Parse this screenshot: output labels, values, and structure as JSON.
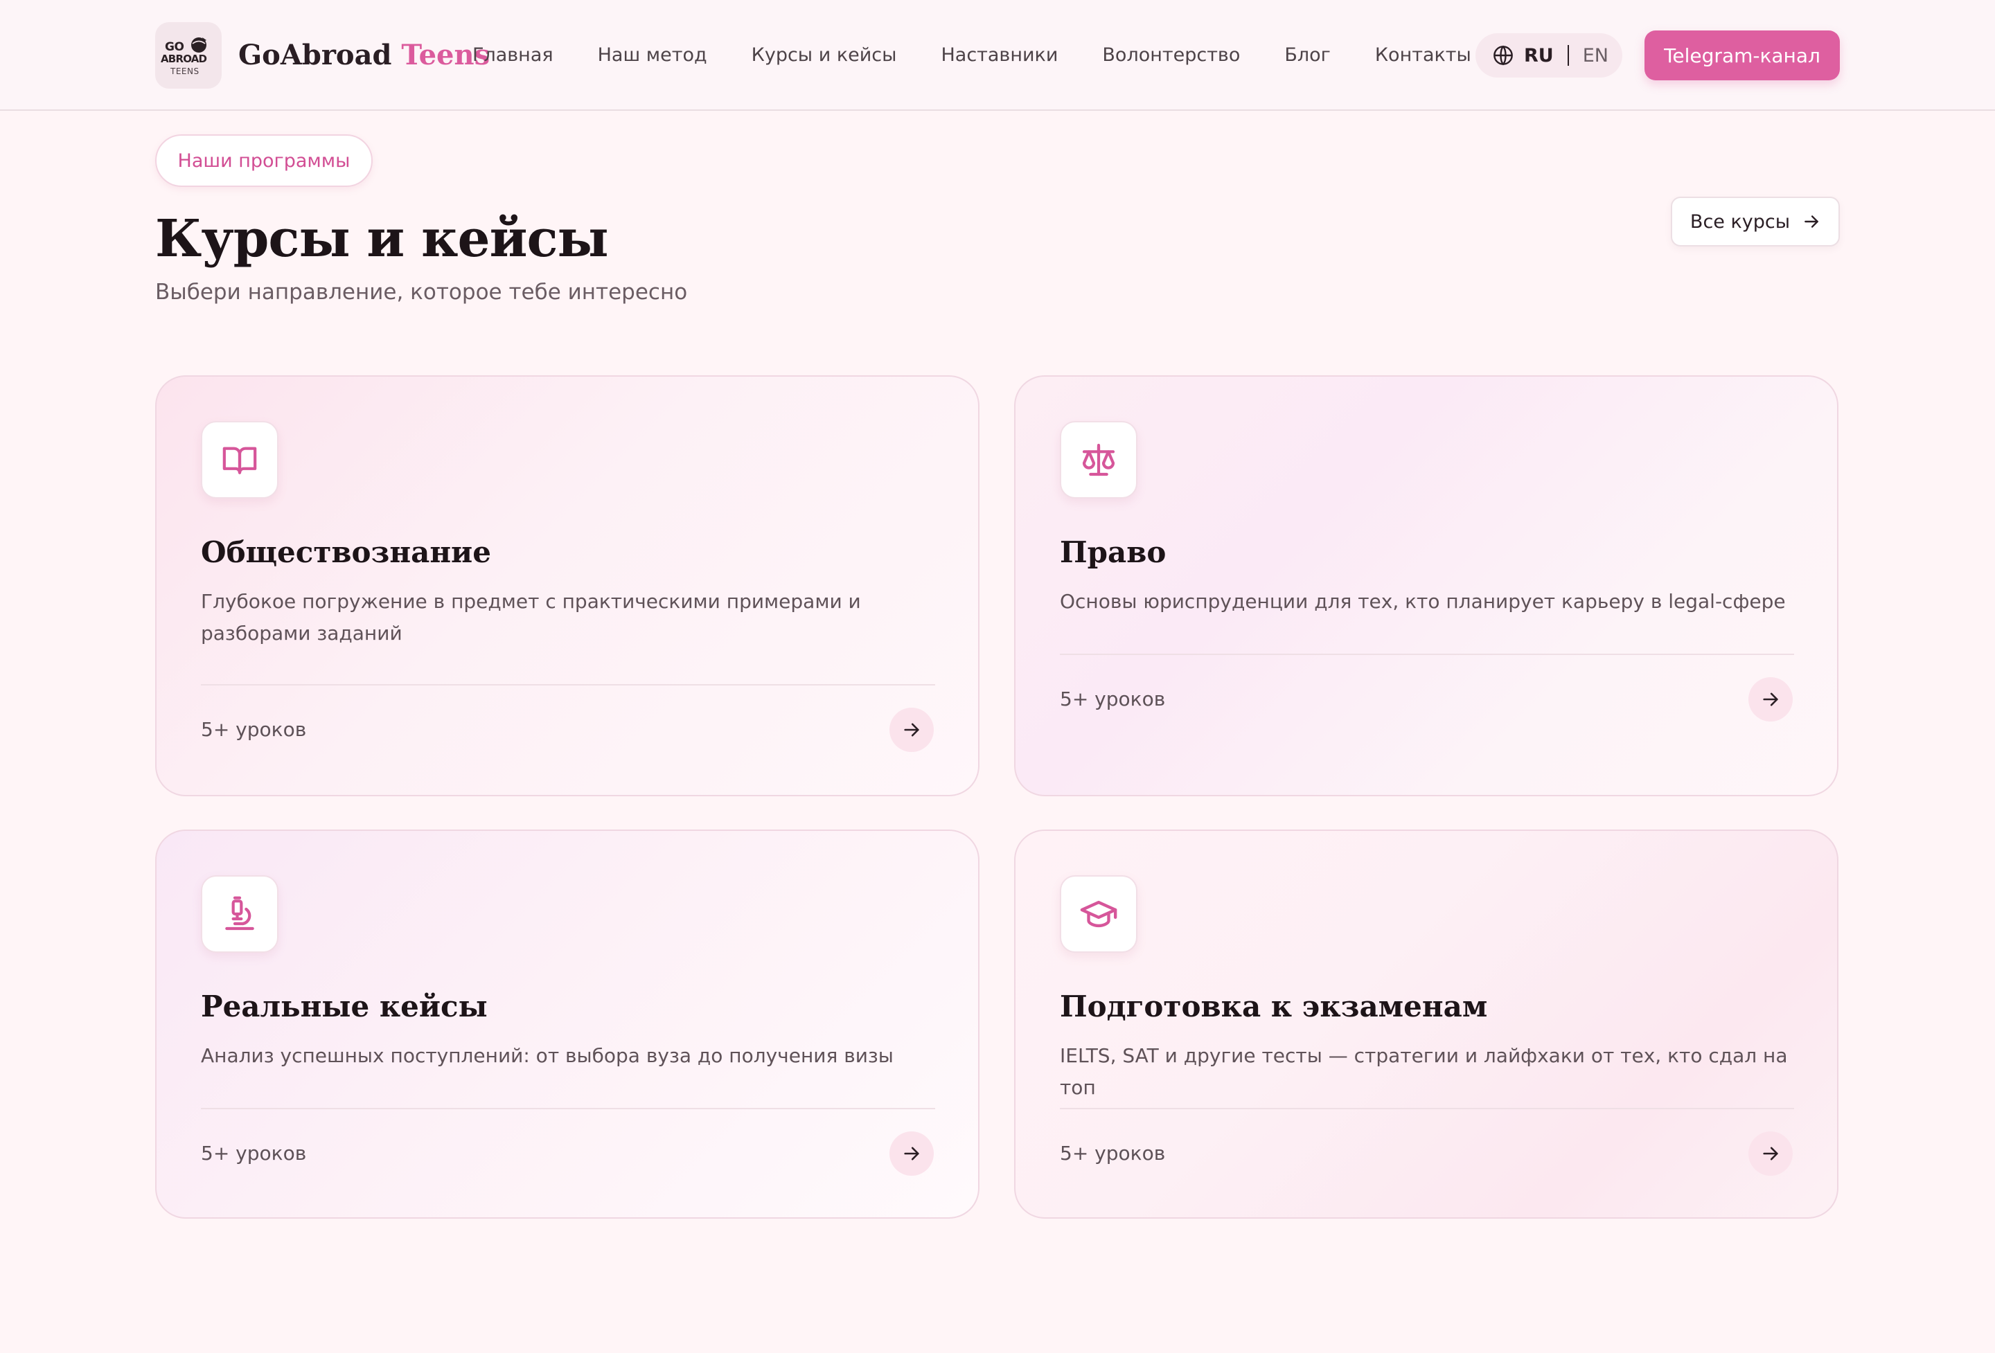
{
  "header": {
    "logo": {
      "line1": "GO",
      "line2": "ABROAD",
      "line3": "TEENS"
    },
    "brand_main": "GoAbroad",
    "brand_accent": "Teens",
    "nav": [
      {
        "label": "Главная"
      },
      {
        "label": "Наш метод"
      },
      {
        "label": "Курсы и кейсы"
      },
      {
        "label": "Наставники"
      },
      {
        "label": "Волонтерство"
      },
      {
        "label": "Блог"
      },
      {
        "label": "Контакты"
      }
    ],
    "lang": {
      "active": "RU",
      "other": "EN"
    },
    "cta": "Telegram-канал"
  },
  "section": {
    "pill": "Наши программы",
    "title": "Курсы и кейсы",
    "subtitle": "Выбери направление, которое тебе интересно",
    "all_courses": "Все курсы"
  },
  "cards": [
    {
      "icon": "book-icon",
      "title": "Обществознание",
      "description": "Глубокое погружение в предмет с практическими примерами и разборами заданий",
      "lessons": "5+ уроков"
    },
    {
      "icon": "scale-icon",
      "title": "Право",
      "description": "Основы юриспруденции для тех, кто планирует карьеру в legal-сфере",
      "lessons": "5+ уроков"
    },
    {
      "icon": "microscope-icon",
      "title": "Реальные кейсы",
      "description": "Анализ успешных поступлений: от выбора вуза до получения визы",
      "lessons": "5+ уроков"
    },
    {
      "icon": "graduation-cap-icon",
      "title": "Подготовка к экзаменам",
      "description": "IELTS, SAT и другие тесты — стратегии и лайфхаки от тех, кто сдал на топ",
      "lessons": "5+ уроков"
    }
  ],
  "colors": {
    "accent": "#de5fa0",
    "background": "#fff5f7",
    "text": "#1d1418"
  }
}
